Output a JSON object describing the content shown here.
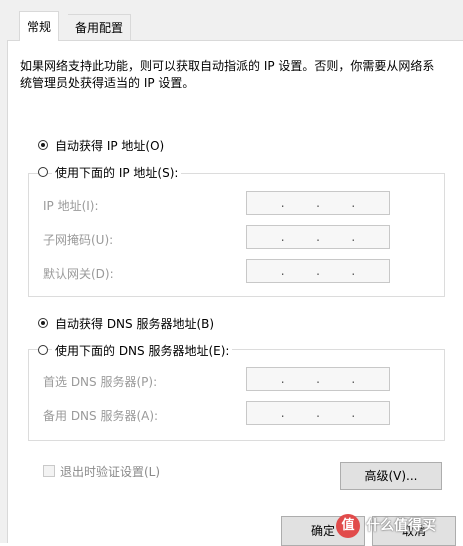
{
  "tabs": [
    {
      "label": "常规"
    },
    {
      "label": "备用配置"
    }
  ],
  "description": "如果网络支持此功能，则可以获取自动指派的 IP 设置。否则，你需要从网络系统管理员处获得适当的 IP 设置。",
  "ip_section": {
    "auto_label": "自动获得 IP 地址(O)",
    "manual_label": "使用下面的 IP 地址(S):",
    "auto_selected": true,
    "fields": [
      {
        "label": "IP 地址(I):",
        "value": ". . ."
      },
      {
        "label": "子网掩码(U):",
        "value": ". . ."
      },
      {
        "label": "默认网关(D):",
        "value": ". . ."
      }
    ]
  },
  "dns_section": {
    "auto_label": "自动获得 DNS 服务器地址(B)",
    "manual_label": "使用下面的 DNS 服务器地址(E):",
    "auto_selected": true,
    "fields": [
      {
        "label": "首选 DNS 服务器(P):",
        "value": ". . ."
      },
      {
        "label": "备用 DNS 服务器(A):",
        "value": ". . ."
      }
    ]
  },
  "validate_checkbox": {
    "label": "退出时验证设置(L)",
    "checked": false,
    "enabled": false
  },
  "buttons": {
    "advanced": "高级(V)...",
    "ok": "确定",
    "cancel": "取消"
  },
  "watermark": {
    "icon": "值",
    "text": "什么值得买"
  }
}
